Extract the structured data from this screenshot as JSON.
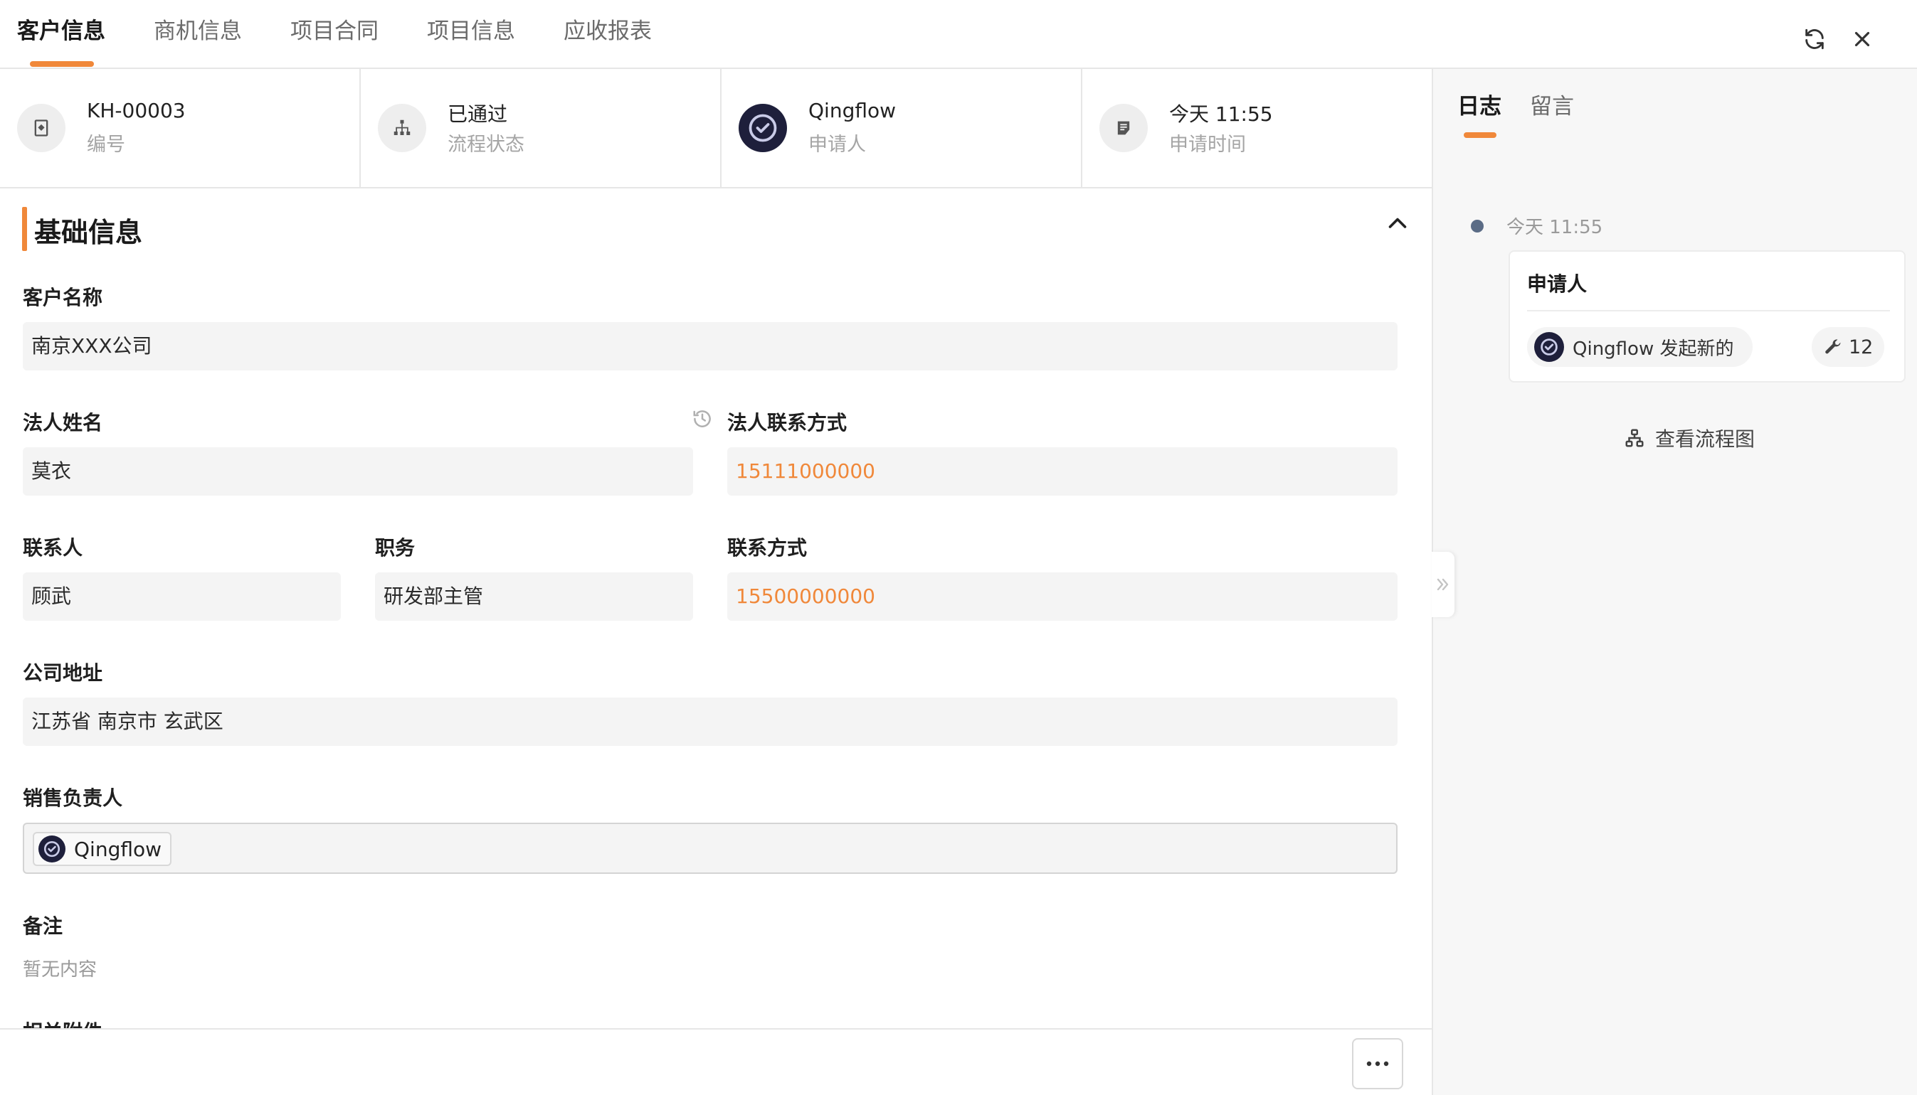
{
  "top_tabs": [
    {
      "label": "客户信息",
      "active": true
    },
    {
      "label": "商机信息",
      "active": false
    },
    {
      "label": "项目合同",
      "active": false
    },
    {
      "label": "项目信息",
      "active": false
    },
    {
      "label": "应收报表",
      "active": false
    }
  ],
  "top_actions": {
    "refresh_icon": "refresh-icon",
    "close_icon": "close-icon"
  },
  "stats": [
    {
      "value": "KH-00003",
      "label": "编号",
      "icon": "bookmark-icon"
    },
    {
      "value": "已通过",
      "label": "流程状态",
      "icon": "hierarchy-icon"
    },
    {
      "value": "Qingflow",
      "label": "申请人",
      "icon": "qingflow-avatar"
    },
    {
      "value": "今天 11:55",
      "label": "申请时间",
      "icon": "edit-note-icon"
    }
  ],
  "section": {
    "title": "基础信息"
  },
  "fields": {
    "customer_name": {
      "label": "客户名称",
      "value": "南京XXX公司"
    },
    "legal_person": {
      "label": "法人姓名",
      "value": "莫衣"
    },
    "legal_contact": {
      "label": "法人联系方式",
      "value": "15111000000"
    },
    "contact_person": {
      "label": "联系人",
      "value": "顾武"
    },
    "position": {
      "label": "职务",
      "value": "研发部主管"
    },
    "contact_info": {
      "label": "联系方式",
      "value": "15500000000"
    },
    "address": {
      "label": "公司地址",
      "value": "江苏省 南京市 玄武区"
    },
    "sales_owner": {
      "label": "销售负责人",
      "value": "Qingflow"
    },
    "remarks": {
      "label": "备注",
      "value": "暂无内容"
    },
    "attachments": {
      "label": "相关附件"
    }
  },
  "side_tabs": [
    {
      "label": "日志",
      "active": true
    },
    {
      "label": "留言",
      "active": false
    }
  ],
  "log": {
    "time": "今天 11:55",
    "title": "申请人",
    "actor": "Qingflow 发起新的",
    "count": "12",
    "flow_link": "查看流程图"
  },
  "colors": {
    "accent": "#f0883a",
    "avatar_bg": "#1e1f3b",
    "timeline_dot": "#5b6c86"
  }
}
